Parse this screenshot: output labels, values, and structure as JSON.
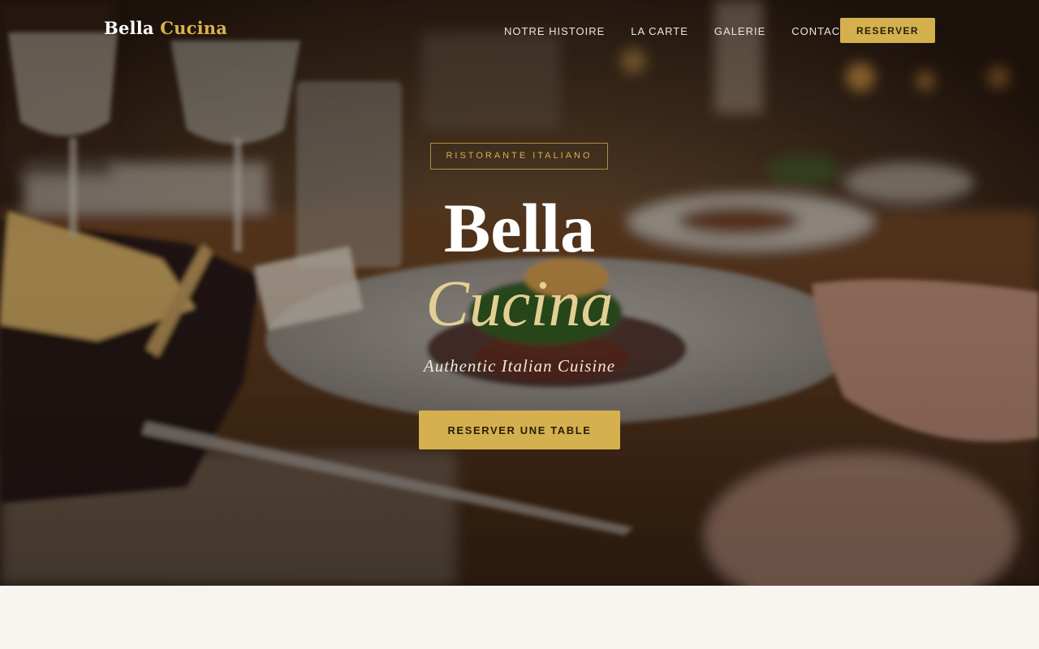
{
  "brand": {
    "name_primary": "Bella",
    "name_accent": "Cucina"
  },
  "nav": {
    "links": [
      "NOTRE HISTOIRE",
      "LA CARTE",
      "GALERIE",
      "CONTACT"
    ],
    "cta_label": "RESERVER"
  },
  "hero": {
    "eyebrow": "RISTORANTE ITALIANO",
    "title_line1": "Bella",
    "title_line2": "Cucina",
    "tagline": "Authentic Italian Cuisine",
    "cta_label": "RESERVER UNE TABLE"
  },
  "colors": {
    "accent_gold": "#d4b04e",
    "title_accent": "#e3cf95",
    "page_background": "#f8f5f0"
  },
  "icons": [
    "hero-photo-dining-table"
  ]
}
